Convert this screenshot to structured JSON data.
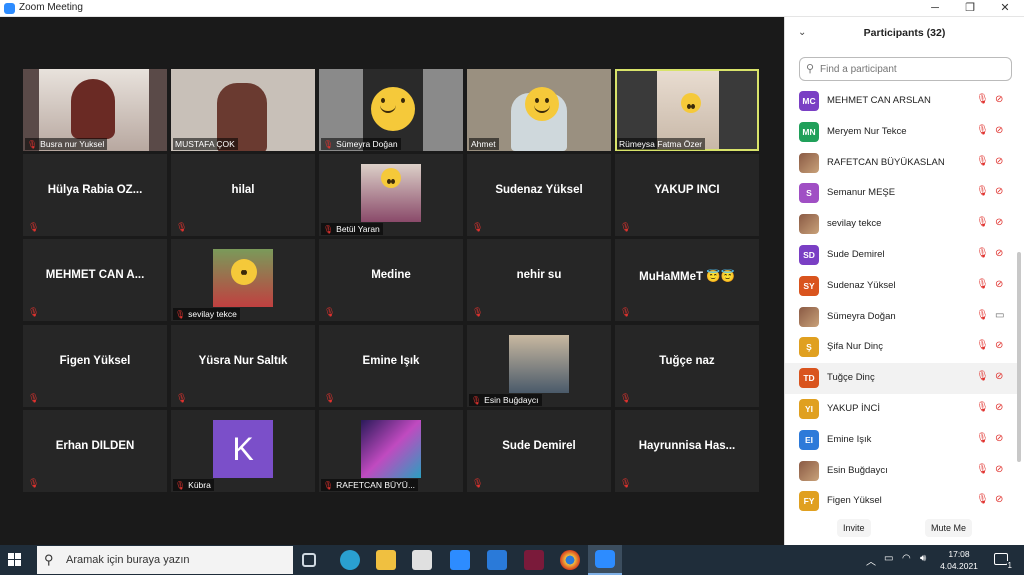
{
  "window": {
    "title": "Zoom Meeting",
    "minimize": "─",
    "maximize": "❐",
    "close": "✕"
  },
  "tiles": [
    {
      "name": "Busra nur Yuksel",
      "muted": true
    },
    {
      "name": "MUSTAFA ÇOK",
      "muted": false
    },
    {
      "name": "Sümeyra Doğan",
      "muted": true
    },
    {
      "name": "Ahmet",
      "muted": false
    },
    {
      "name": "Rümeysa Fatma Özer",
      "muted": false
    },
    {
      "name": "Hülya Rabia ÖZ..."
    },
    {
      "name": "hilal"
    },
    {
      "name": "Betül Yaran"
    },
    {
      "name": "Sudenaz Yüksel"
    },
    {
      "name": "YAKUP İNCİ"
    },
    {
      "name": "MEHMET CAN A..."
    },
    {
      "name": "sevilay tekce"
    },
    {
      "name": "Medine"
    },
    {
      "name": "nehir su"
    },
    {
      "name": "MuHaMMeT 😇😇"
    },
    {
      "name": "Figen Yüksel"
    },
    {
      "name": "Yüsra Nur Saltık"
    },
    {
      "name": "Emine Işık"
    },
    {
      "name": "Esin Buğdaycı"
    },
    {
      "name": "Tuğçe naz"
    },
    {
      "name": "Erhan DILDEN"
    },
    {
      "name": "Kübra",
      "initial": "K"
    },
    {
      "name": "RAFETCAN BÜYÜ..."
    },
    {
      "name": "Sude Demirel"
    },
    {
      "name": "Hayrunnisa Has..."
    }
  ],
  "panel": {
    "title": "Participants (32)",
    "search_placeholder": "Find a participant",
    "invite": "Invite",
    "mute_me": "Mute Me",
    "participants": [
      {
        "initials": "MC",
        "name": "MEHMET CAN ARSLAN",
        "color": "#7a3fc4",
        "video": false
      },
      {
        "initials": "MN",
        "name": "Meryem Nur Tekce",
        "color": "#20a05a",
        "video": false
      },
      {
        "initials": "",
        "name": "RAFETCAN BÜYÜKASLAN",
        "color": "#3a3aa0",
        "video": false,
        "photo": true
      },
      {
        "initials": "S",
        "name": "Semanur MEŞE",
        "color": "#a04fc4",
        "video": false
      },
      {
        "initials": "",
        "name": "sevilay tekce",
        "color": "#c04040",
        "video": false,
        "photo": true
      },
      {
        "initials": "SD",
        "name": "Sude Demirel",
        "color": "#7a3fc4",
        "video": false
      },
      {
        "initials": "SY",
        "name": "Sudenaz Yüksel",
        "color": "#d9541e",
        "video": false
      },
      {
        "initials": "",
        "name": "Sümeyra Doğan",
        "color": "#6a8a4a",
        "video": true,
        "photo": true
      },
      {
        "initials": "Ş",
        "name": "Şifa Nur Dinç",
        "color": "#e0a020",
        "video": false
      },
      {
        "initials": "TD",
        "name": "Tuğçe Dinç",
        "color": "#d9541e",
        "video": false,
        "highlight": true
      },
      {
        "initials": "YI",
        "name": "YAKUP İNCİ",
        "color": "#e0a020",
        "video": false
      },
      {
        "initials": "EI",
        "name": "Emine Işık",
        "color": "#2d7ad9",
        "video": false
      },
      {
        "initials": "",
        "name": "Esin Buğdaycı",
        "color": "#8a6a4a",
        "video": false,
        "photo": true
      },
      {
        "initials": "FY",
        "name": "Figen Yüksel",
        "color": "#e0a020",
        "video": false
      }
    ]
  },
  "taskbar": {
    "search_placeholder": "Aramak için buraya yazın",
    "time": "17:08",
    "date": "4.04.2021",
    "notifications": "1"
  }
}
